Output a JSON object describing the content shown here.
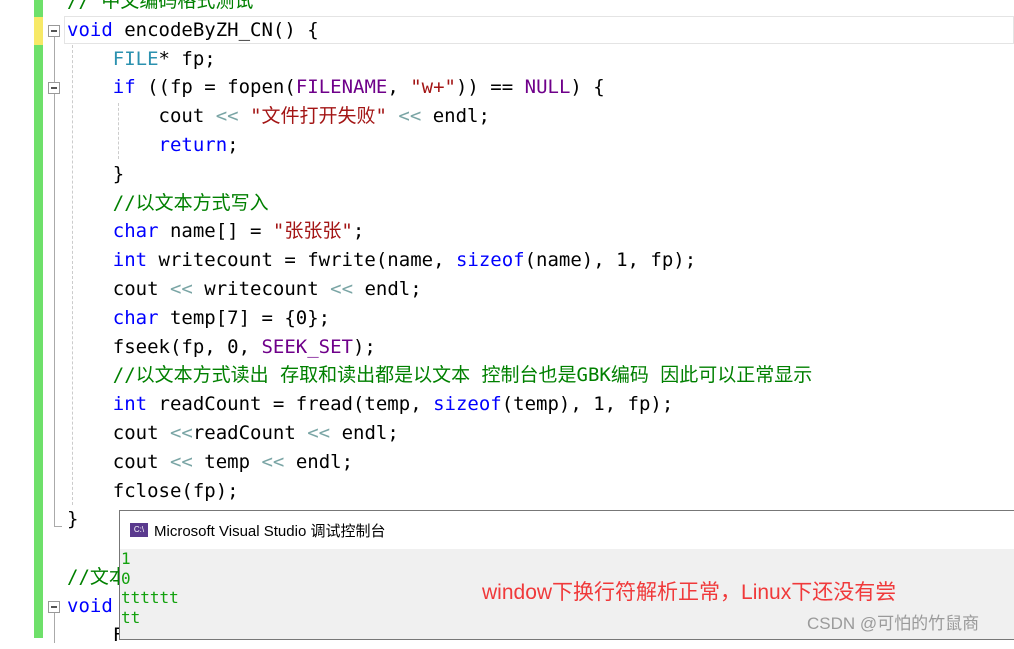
{
  "editor": {
    "lines": [
      [
        [
          "// 中文编码格式测试",
          "cm"
        ]
      ],
      [
        [
          "void",
          "kw"
        ],
        [
          " encodeByZH_CN() {",
          "tx"
        ]
      ],
      [
        [
          "    ",
          "tx"
        ],
        [
          "FILE",
          "ty"
        ],
        [
          "* fp;",
          "tx"
        ]
      ],
      [
        [
          "    ",
          "tx"
        ],
        [
          "if",
          "kw"
        ],
        [
          " ((fp = fopen(",
          "tx"
        ],
        [
          "FILENAME",
          "mac"
        ],
        [
          ", ",
          "tx"
        ],
        [
          "\"w+\"",
          "str"
        ],
        [
          ")) == ",
          "tx"
        ],
        [
          "NULL",
          "mac"
        ],
        [
          ") {",
          "tx"
        ]
      ],
      [
        [
          "        cout ",
          "tx"
        ],
        [
          "<<",
          "op"
        ],
        [
          " ",
          "tx"
        ],
        [
          "\"文件打开失败\"",
          "str"
        ],
        [
          " ",
          "tx"
        ],
        [
          "<<",
          "op"
        ],
        [
          " endl;",
          "tx"
        ]
      ],
      [
        [
          "        ",
          "tx"
        ],
        [
          "return",
          "kw"
        ],
        [
          ";",
          "tx"
        ]
      ],
      [
        [
          "    }",
          "tx"
        ]
      ],
      [
        [
          "    ",
          "tx"
        ],
        [
          "//以文本方式写入",
          "cm"
        ]
      ],
      [
        [
          "    ",
          "tx"
        ],
        [
          "char",
          "kw"
        ],
        [
          " name[] = ",
          "tx"
        ],
        [
          "\"张张张\"",
          "str"
        ],
        [
          ";",
          "tx"
        ]
      ],
      [
        [
          "    ",
          "tx"
        ],
        [
          "int",
          "kw"
        ],
        [
          " writecount = fwrite(name, ",
          "tx"
        ],
        [
          "sizeof",
          "kw"
        ],
        [
          "(name), 1, fp);",
          "tx"
        ]
      ],
      [
        [
          "    cout ",
          "tx"
        ],
        [
          "<<",
          "op"
        ],
        [
          " writecount ",
          "tx"
        ],
        [
          "<<",
          "op"
        ],
        [
          " endl;",
          "tx"
        ]
      ],
      [
        [
          "    ",
          "tx"
        ],
        [
          "char",
          "kw"
        ],
        [
          " temp[7] = {0};",
          "tx"
        ]
      ],
      [
        [
          "    fseek(fp, 0, ",
          "tx"
        ],
        [
          "SEEK_SET",
          "mac"
        ],
        [
          ");",
          "tx"
        ]
      ],
      [
        [
          "    ",
          "tx"
        ],
        [
          "//以文本方式读出 存取和读出都是以文本 控制台也是GBK编码 因此可以正常显示",
          "cm"
        ]
      ],
      [
        [
          "    ",
          "tx"
        ],
        [
          "int",
          "kw"
        ],
        [
          " readCount = fread(temp, ",
          "tx"
        ],
        [
          "sizeof",
          "kw"
        ],
        [
          "(temp), 1, fp);",
          "tx"
        ]
      ],
      [
        [
          "    cout ",
          "tx"
        ],
        [
          "<<",
          "op"
        ],
        [
          "readCount ",
          "tx"
        ],
        [
          "<<",
          "op"
        ],
        [
          " endl;",
          "tx"
        ]
      ],
      [
        [
          "    cout ",
          "tx"
        ],
        [
          "<<",
          "op"
        ],
        [
          " temp ",
          "tx"
        ],
        [
          "<<",
          "op"
        ],
        [
          " endl;",
          "tx"
        ]
      ],
      [
        [
          "    fclose(fp);",
          "tx"
        ]
      ],
      [
        [
          "}",
          "tx"
        ]
      ],
      [
        [
          "",
          "tx"
        ]
      ],
      [
        [
          "//文本方式",
          "cm"
        ]
      ],
      [
        [
          "void",
          "kw"
        ],
        [
          " ",
          "tx"
        ]
      ],
      [
        [
          "    F",
          "tx"
        ]
      ]
    ]
  },
  "console": {
    "icon": "C:\\",
    "title": "Microsoft Visual Studio 调试控制台",
    "output": [
      "1",
      "0",
      "tttttt",
      "tt"
    ],
    "annotation": "window下换行符解析正常，Linux下还没有尝",
    "watermark": "CSDN @可怕的竹鼠商"
  },
  "colors": {
    "keyword": "#0000ff",
    "type": "#2b91af",
    "macro": "#6f008a",
    "string": "#a31515",
    "comment": "#008000",
    "console_text": "#13a10e",
    "annotation": "#f0393a"
  }
}
